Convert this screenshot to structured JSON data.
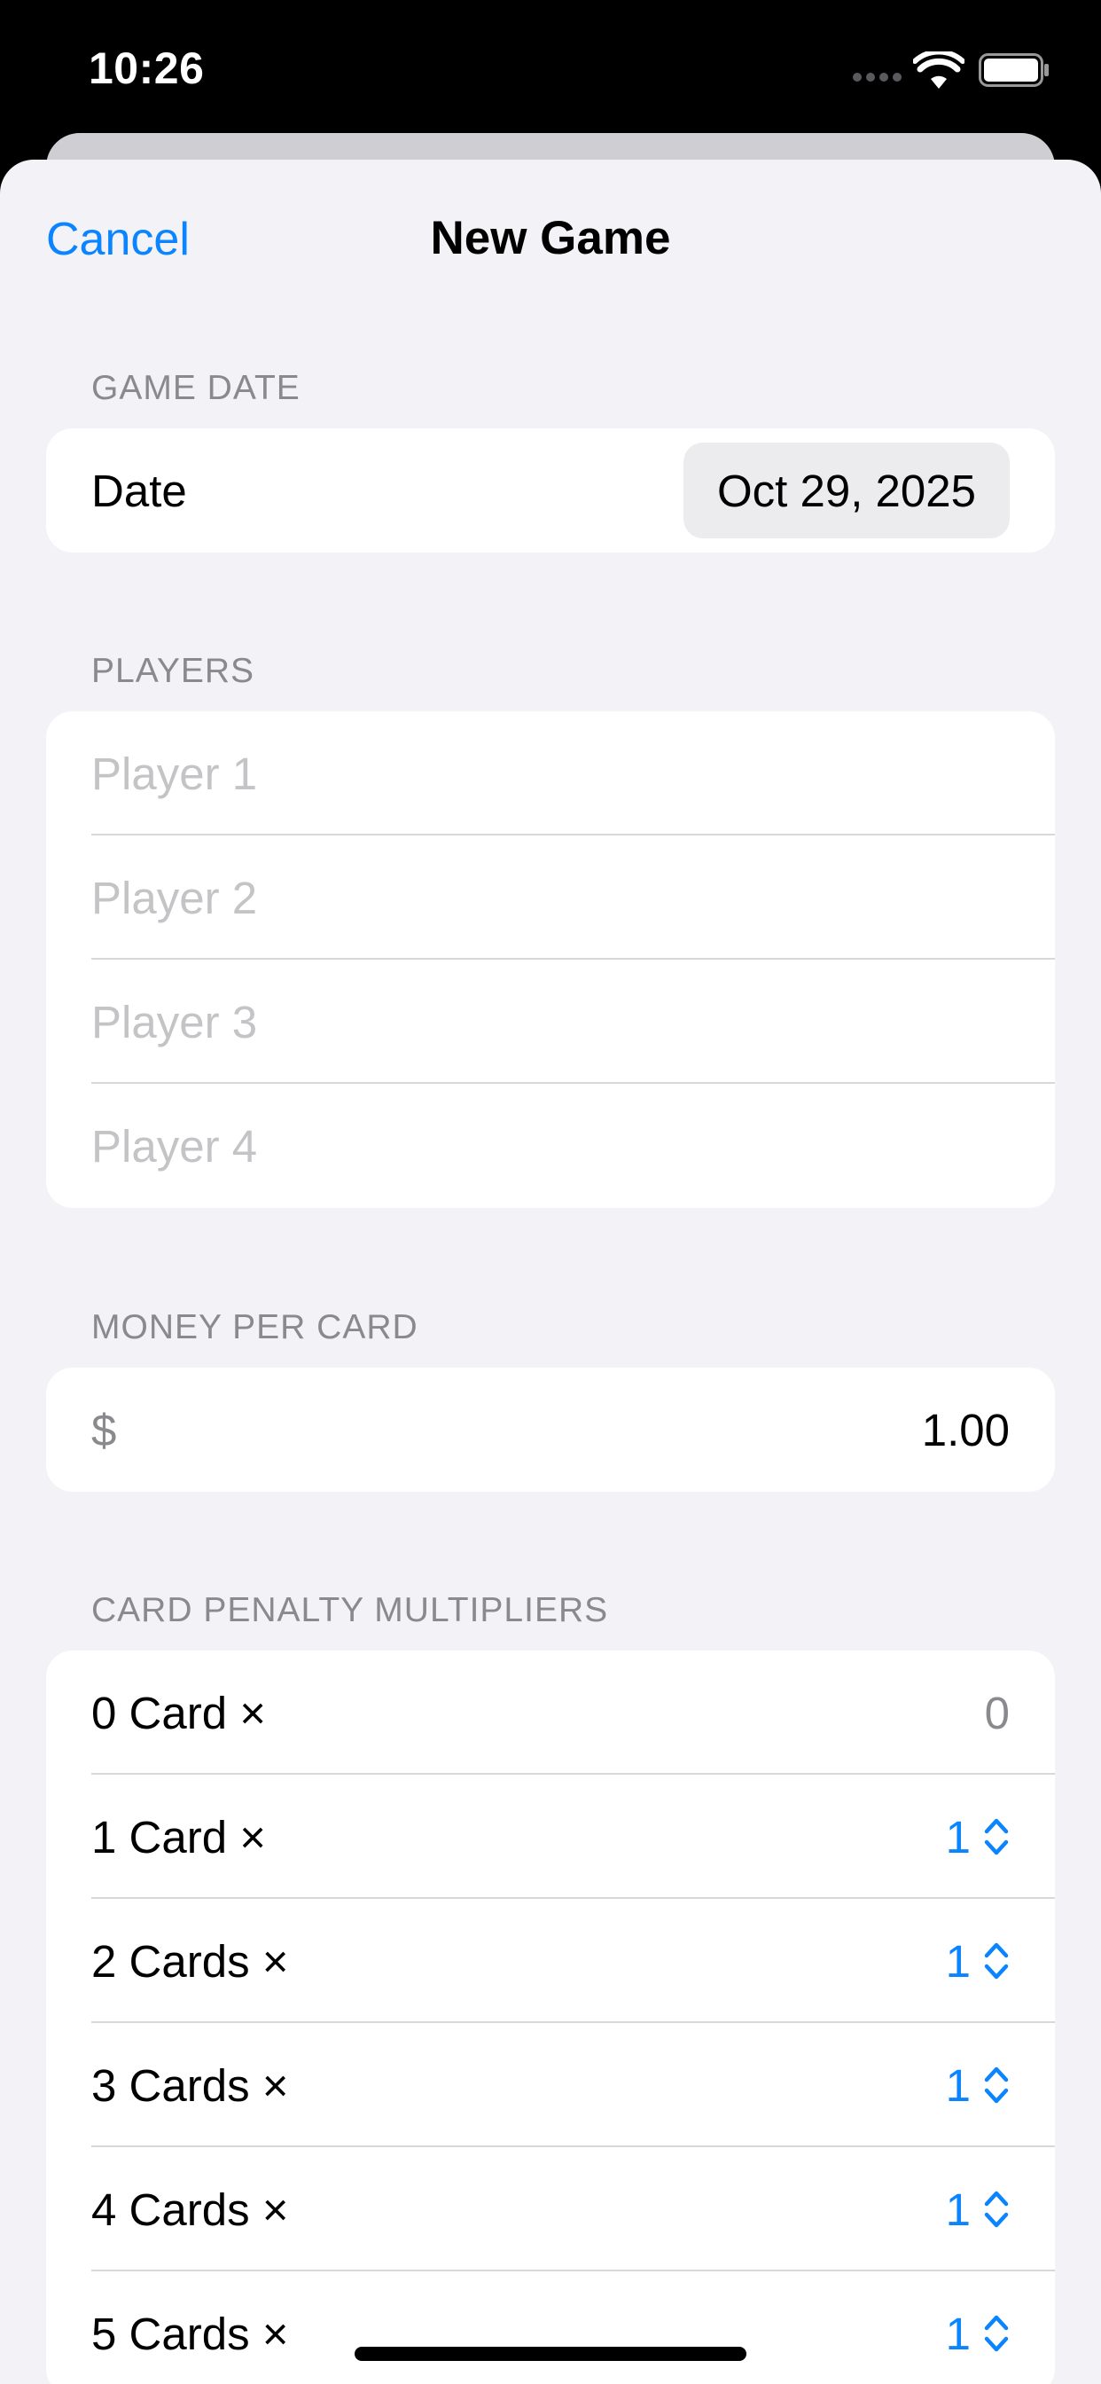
{
  "status_bar": {
    "time": "10:26"
  },
  "nav": {
    "cancel_label": "Cancel",
    "title": "New Game"
  },
  "game_date": {
    "header": "GAME DATE",
    "label": "Date",
    "value": "Oct 29, 2025"
  },
  "players": {
    "header": "PLAYERS",
    "placeholders": [
      "Player 1",
      "Player 2",
      "Player 3",
      "Player 4"
    ]
  },
  "money": {
    "header": "MONEY PER CARD",
    "currency": "$",
    "value": "1.00"
  },
  "multipliers": {
    "header": "CARD PENALTY MULTIPLIERS",
    "rows": [
      {
        "label": "0 Card ×",
        "value": "0"
      },
      {
        "label": "1 Card ×",
        "value": "1"
      },
      {
        "label": "2 Cards ×",
        "value": "1"
      },
      {
        "label": "3 Cards ×",
        "value": "1"
      },
      {
        "label": "4 Cards ×",
        "value": "1"
      },
      {
        "label": "5 Cards ×",
        "value": "1"
      }
    ]
  },
  "colors": {
    "accent": "#0a84ff",
    "background": "#f2f2f7"
  }
}
